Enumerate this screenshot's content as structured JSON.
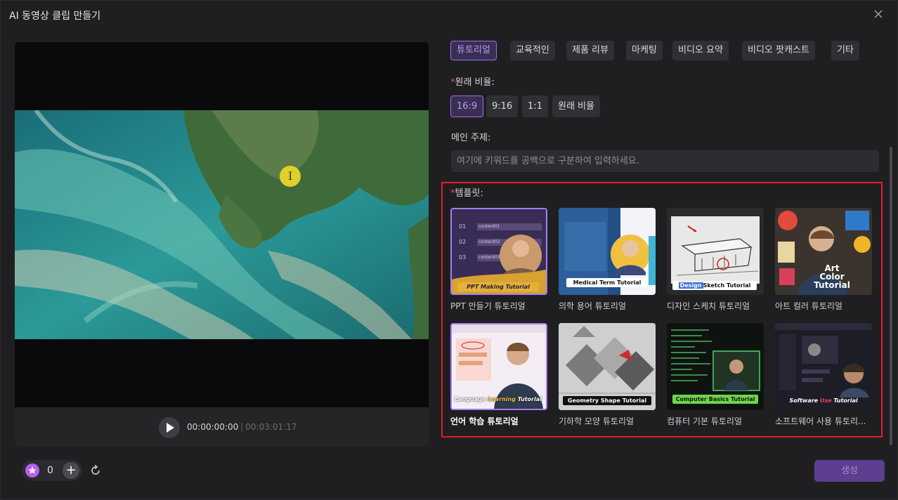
{
  "window": {
    "title": "AI 동영상 클립 만들기"
  },
  "player": {
    "current_time": "00:00:00:00",
    "separator": "|",
    "total_time": "00:03:01:17",
    "cursor_glyph": "I"
  },
  "categories": [
    "튜토리얼",
    "교육적인",
    "제품 리뷰",
    "마케팅",
    "비디오 요약",
    "비디오 팟캐스트",
    "기타"
  ],
  "aspect": {
    "required_mark": "*",
    "label": "원래 비율:",
    "options": [
      "16:9",
      "9:16",
      "1:1",
      "원래 비율"
    ]
  },
  "topic": {
    "label": "메인 주제:",
    "placeholder": "여기에 키워드를 공백으로 구분하여 입력하세요."
  },
  "templates": {
    "required_mark": "*",
    "label": "템플릿:",
    "items": [
      {
        "name": "PPT 만들기 튜토리얼",
        "thumb_text": "PPT Making Tutorial",
        "rows": [
          "01",
          "02",
          "03"
        ],
        "row_label_1": "content01",
        "row_label_2": "content02",
        "row_label_3": "content03"
      },
      {
        "name": "의학 용어 튜토리얼",
        "thumb_text": "Medical Term Tutorial"
      },
      {
        "name": "디자인 스케치 튜토리얼",
        "thumb_text_a": "Design",
        "thumb_text_b": "Sketch Tutorial"
      },
      {
        "name": "아트 컬러 튜토리얼",
        "thumb_text_1": "Art",
        "thumb_text_2": "Color",
        "thumb_text_3": "Tutorial"
      },
      {
        "name": "언어 학습 튜토리얼",
        "thumb_text_a": "Language ",
        "thumb_text_b": "Learning",
        "thumb_text_c": " Tutorial"
      },
      {
        "name": "기하학 모양 튜토리얼",
        "thumb_text": "Geometry Shape Tutorial"
      },
      {
        "name": "컴퓨터 기본 튜토리얼",
        "thumb_text": "Computer Basics Tutorial"
      },
      {
        "name": "소프트웨어 사용 튜토리...",
        "thumb_text_a": "Software ",
        "thumb_text_b": "Use",
        "thumb_text_c": " Tutorial"
      }
    ]
  },
  "footer": {
    "credits": "0",
    "plus": "+",
    "generate": "생성"
  },
  "colors": {
    "accent": "#9a6ef0",
    "highlight_box": "#e01e2a",
    "generate_bg": "#5c3f91"
  }
}
